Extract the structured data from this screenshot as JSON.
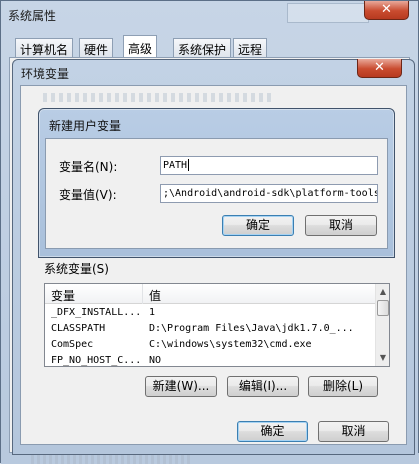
{
  "system_properties": {
    "title": "系统属性",
    "close_glyph": "✕",
    "tabs": [
      "计算机名",
      "硬件",
      "高级",
      "系统保护",
      "远程"
    ],
    "selected_tab": "高级"
  },
  "env_vars": {
    "title": "环境变量",
    "close_glyph": "✕",
    "system_section_label": "系统变量(S)",
    "columns": [
      "变量",
      "值"
    ],
    "rows": [
      {
        "name": "_DFX_INSTALL...",
        "value": "1"
      },
      {
        "name": "CLASSPATH",
        "value": "D:\\Program Files\\Java\\jdk1.7.0_..."
      },
      {
        "name": "ComSpec",
        "value": "C:\\windows\\system32\\cmd.exe"
      },
      {
        "name": "FP_NO_HOST_C...",
        "value": "NO"
      }
    ],
    "buttons": {
      "new": "新建(W)...",
      "edit": "编辑(I)...",
      "delete": "删除(L)"
    },
    "ok": "确定",
    "cancel": "取消"
  },
  "new_var_dialog": {
    "title": "新建用户变量",
    "name_label": "变量名(N):",
    "value_label": "变量值(V):",
    "name_value": "PATH",
    "value_value": ";\\Android\\android-sdk\\platform-tools",
    "ok": "确定",
    "cancel": "取消"
  }
}
